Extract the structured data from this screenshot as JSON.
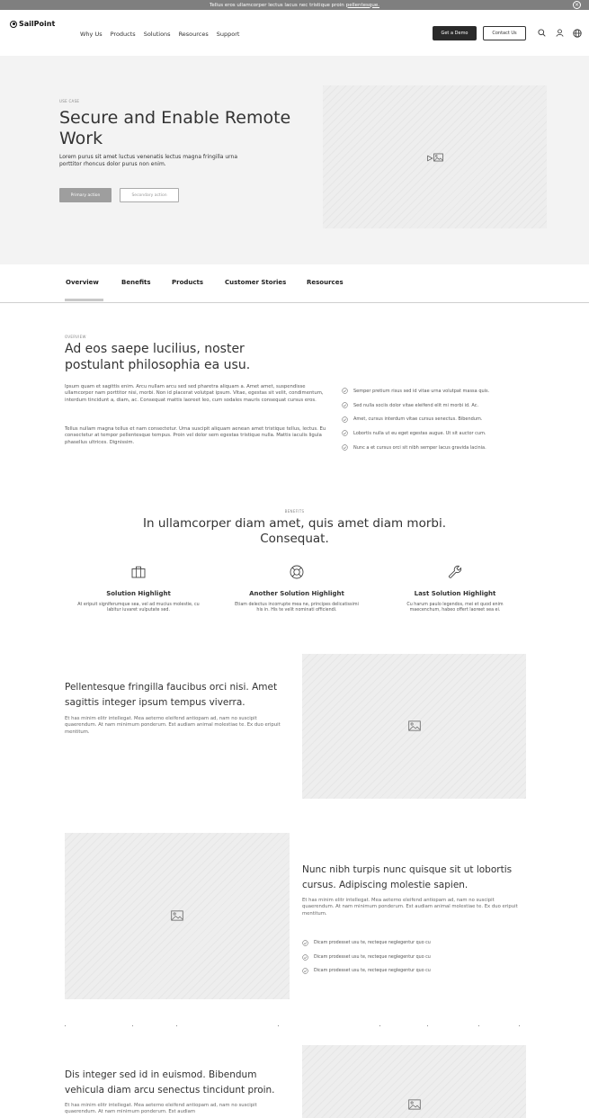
{
  "banner": {
    "text": "Tellus eros ullamcorper lectus lacus nec tristique proin",
    "link": "pellentesque."
  },
  "nav": {
    "logo": "SailPoint",
    "items": [
      "Why Us",
      "Products",
      "Solutions",
      "Resources",
      "Support"
    ],
    "demo_button": "Get a Demo",
    "contact_button": "Contact Us",
    "icons": [
      "search-icon",
      "user-icon",
      "globe-icon"
    ]
  },
  "hero": {
    "eyebrow": "USE CASE",
    "title": "Secure and Enable Remote Work",
    "description": "Lorem purus sit amet luctus venenatis lectus magna fringilla urna porttitor rhoncus dolor purus non enim.",
    "primary_action": "Primary action",
    "secondary_action": "Secondary action"
  },
  "tabs": [
    "Overview",
    "Benefits",
    "Products",
    "Customer Stories",
    "Resources"
  ],
  "overview": {
    "eyebrow": "OVERVIEW",
    "title": "Ad eos saepe lucilius, noster postulant philosophia ea usu.",
    "paragraph1": "Ipsum quam et sagittis enim. Arcu nullam arcu sed sed pharetra aliquam a. Amet amet, suspendisse ullamcorper nam porttitor nisi, morbi. Non id placerat volutpat ipsum. Vitae, egestas sit velit, condimentum, interdum tincidunt a, diam, ac. Consequat mattis laoreet leo, cum sodales mauris consequat cursus eros.",
    "paragraph2": "Tellus nullam magna tellus et nam consectetur. Urna suscipit aliquam aenean amet tristique tellus, lectus. Eu consectetur at tempor pellentesque tempus. Proin vel dolor sem egestas tristique nulla. Mattis iaculis ligula phasellus ultrices. Dignissim.",
    "checks": [
      "Semper pretium risus sed id vitae urna volutpat massa quis.",
      "Sed nulla sociis dolor vitae eleifend elit mi morbi id. Ac.",
      "Amet, cursus interdum vitae cursus senectus. Bibendum.",
      "Lobortis nulla ut eu eget egestas augue. Ut sit auctor cum.",
      "Nunc a et cursus orci sit nibh semper lacus gravida lacinia."
    ]
  },
  "benefits": {
    "eyebrow": "BENEFITS",
    "title": "In ullamcorper diam amet, quis amet diam morbi. Consequat.",
    "features": [
      {
        "icon": "briefcase-icon",
        "title": "Solution Highlight",
        "text": "At eripuit signiferumque sea, vel ad mucius molestie, cu labitur iuvaret vulputate sed."
      },
      {
        "icon": "lifebuoy-icon",
        "title": "Another Solution Highlight",
        "text": "Etiam delectus incorrupte mea ne, principes delicatissimi his in. His te velit nominati officiendi."
      },
      {
        "icon": "wrench-icon",
        "title": "Last Solution Highlight",
        "text": "Cu harum paulo legendos, mei et quod enim maecenchum, habeo offert laoreet sea ei."
      }
    ]
  },
  "split1": {
    "title": "Pellentesque fringilla faucibus orci nisi. Amet sagittis integer ipsum tempus viverra.",
    "text": "Et has minim elitr intellegat. Mea aeterno eleifend antiopam ad, nam no suscipit quaerendum. At nam minimum ponderum. Est audiam animal molestiae te. Ex duo eripuit mentitum."
  },
  "split2": {
    "title": "Nunc nibh turpis nunc quisque sit ut lobortis cursus. Adipiscing molestie sapien.",
    "text": "Et has minim elitr intellegat. Mea aeterno eleifend antiopam ad, nam no suscipit quaerendum. At nam minimum ponderum. Est audiam animal molestiae te. Ex duo eripuit mentitum.",
    "checks": [
      "Dicam prodesset usu te, recteque neglegentur quo cu",
      "Dicam prodesset usu te, recteque neglegentur quo cu",
      "Dicam prodesset usu te, recteque neglegentur quo cu"
    ]
  },
  "split3": {
    "title": "Dis integer sed id in euismod. Bibendum vehicula diam arcu senectus tincidunt proin.",
    "text": "Et has minim elitr intellegat. Mea aeterno eleifend antiopam ad, nam no suscipit quaerendum. At nam minimum ponderum. Est audiam"
  }
}
